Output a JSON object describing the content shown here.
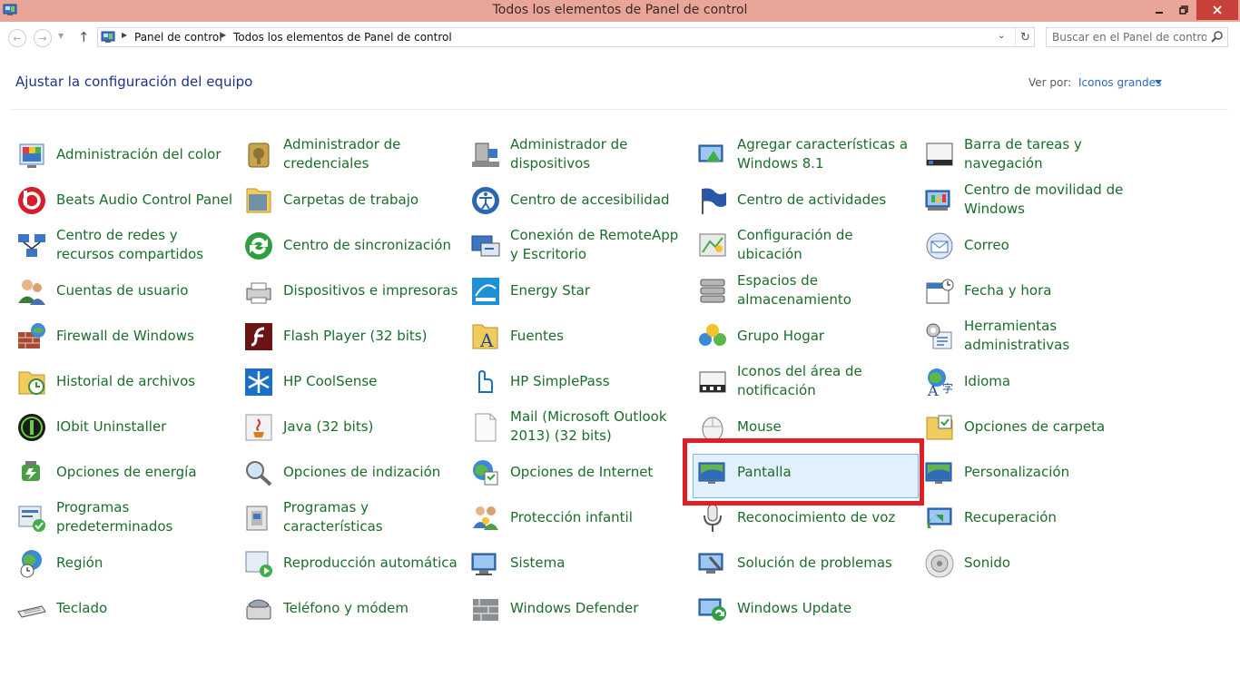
{
  "window": {
    "title": "Todos los elementos de Panel de control"
  },
  "breadcrumbs": [
    "Panel de control",
    "Todos los elementos de Panel de control"
  ],
  "search": {
    "placeholder": "Buscar en el Panel de control"
  },
  "header": {
    "title": "Ajustar la configuración del equipo",
    "view_by_label": "Ver por:",
    "view_by_value": "Iconos grandes"
  },
  "columns": [
    [
      {
        "label": "Administración del color",
        "icon": "color-management-icon"
      },
      {
        "label": "Beats Audio Control Panel",
        "icon": "beats-audio-icon"
      },
      {
        "label": "Centro de redes y recursos compartidos",
        "icon": "network-center-icon"
      },
      {
        "label": "Cuentas de usuario",
        "icon": "user-accounts-icon"
      },
      {
        "label": "Firewall de Windows",
        "icon": "firewall-icon"
      },
      {
        "label": "Historial de archivos",
        "icon": "file-history-icon"
      },
      {
        "label": "IObit Uninstaller",
        "icon": "iobit-uninstaller-icon"
      },
      {
        "label": "Opciones de energía",
        "icon": "power-options-icon"
      },
      {
        "label": "Programas predeterminados",
        "icon": "default-programs-icon"
      },
      {
        "label": "Región",
        "icon": "region-icon"
      },
      {
        "label": "Teclado",
        "icon": "keyboard-icon"
      }
    ],
    [
      {
        "label": "Administrador de credenciales",
        "icon": "credential-manager-icon"
      },
      {
        "label": "Carpetas de trabajo",
        "icon": "work-folders-icon"
      },
      {
        "label": "Centro de sincronización",
        "icon": "sync-center-icon"
      },
      {
        "label": "Dispositivos e impresoras",
        "icon": "devices-printers-icon"
      },
      {
        "label": "Flash Player (32 bits)",
        "icon": "flash-player-icon"
      },
      {
        "label": "HP CoolSense",
        "icon": "hp-coolsense-icon"
      },
      {
        "label": "Java (32 bits)",
        "icon": "java-icon"
      },
      {
        "label": "Opciones de indización",
        "icon": "indexing-options-icon"
      },
      {
        "label": "Programas y características",
        "icon": "programs-features-icon"
      },
      {
        "label": "Reproducción automática",
        "icon": "autoplay-icon"
      },
      {
        "label": "Teléfono y módem",
        "icon": "phone-modem-icon"
      }
    ],
    [
      {
        "label": "Administrador de dispositivos",
        "icon": "device-manager-icon"
      },
      {
        "label": "Centro de accesibilidad",
        "icon": "ease-of-access-icon"
      },
      {
        "label": "Conexión de RemoteApp y Escritorio",
        "icon": "remoteapp-icon"
      },
      {
        "label": "Energy Star",
        "icon": "energy-star-icon"
      },
      {
        "label": "Fuentes",
        "icon": "fonts-icon"
      },
      {
        "label": "HP SimplePass",
        "icon": "hp-simplepass-icon"
      },
      {
        "label": "Mail (Microsoft Outlook 2013) (32 bits)",
        "icon": "mail-icon"
      },
      {
        "label": "Opciones de Internet",
        "icon": "internet-options-icon"
      },
      {
        "label": "Protección infantil",
        "icon": "family-safety-icon"
      },
      {
        "label": "Sistema",
        "icon": "system-icon"
      },
      {
        "label": "Windows Defender",
        "icon": "windows-defender-icon"
      }
    ],
    [
      {
        "label": "Agregar características a Windows 8.1",
        "icon": "add-features-icon"
      },
      {
        "label": "Centro de actividades",
        "icon": "action-center-icon"
      },
      {
        "label": "Configuración de ubicación",
        "icon": "location-settings-icon"
      },
      {
        "label": "Espacios de almacenamiento",
        "icon": "storage-spaces-icon"
      },
      {
        "label": "Grupo Hogar",
        "icon": "homegroup-icon"
      },
      {
        "label": "Iconos del área de notificación",
        "icon": "notification-icons-icon"
      },
      {
        "label": "Mouse",
        "icon": "mouse-icon"
      },
      {
        "label": "Pantalla",
        "icon": "display-icon"
      },
      {
        "label": "Reconocimiento de voz",
        "icon": "speech-recognition-icon"
      },
      {
        "label": "Solución de problemas",
        "icon": "troubleshooting-icon"
      },
      {
        "label": "Windows Update",
        "icon": "windows-update-icon"
      }
    ],
    [
      {
        "label": "Barra de tareas y navegación",
        "icon": "taskbar-icon"
      },
      {
        "label": "Centro de movilidad de Windows",
        "icon": "mobility-center-icon"
      },
      {
        "label": "Correo",
        "icon": "correo-icon"
      },
      {
        "label": "Fecha y hora",
        "icon": "date-time-icon"
      },
      {
        "label": "Herramientas administrativas",
        "icon": "admin-tools-icon"
      },
      {
        "label": "Idioma",
        "icon": "language-icon"
      },
      {
        "label": "Opciones de carpeta",
        "icon": "folder-options-icon"
      },
      {
        "label": "Personalización",
        "icon": "personalization-icon"
      },
      {
        "label": "Recuperación",
        "icon": "recovery-icon"
      },
      {
        "label": "Sonido",
        "icon": "sound-icon"
      }
    ]
  ],
  "selected_item": "Pantalla",
  "colors": {
    "titlebar": "#e8a598",
    "close": "#c7403a",
    "link_green": "#1a6d2b",
    "title_blue": "#1e3287",
    "highlight": "#e01e25"
  }
}
